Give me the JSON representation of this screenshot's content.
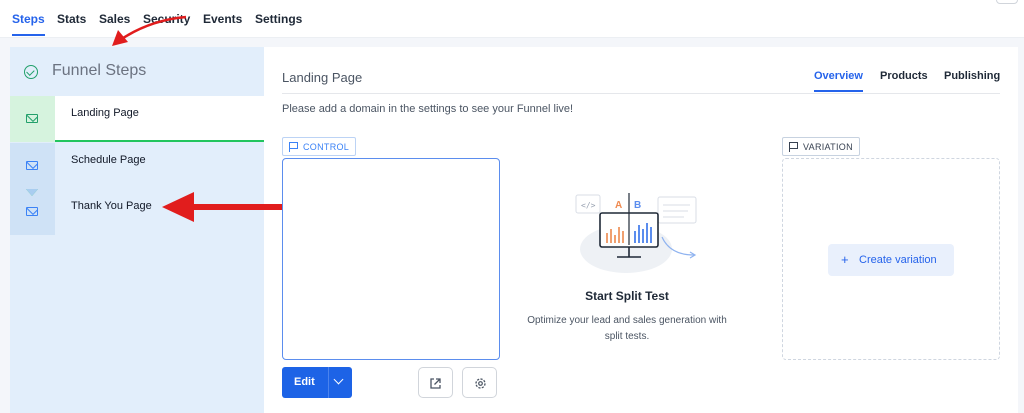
{
  "top_tabs": [
    {
      "label": "Steps",
      "active": true
    },
    {
      "label": "Stats",
      "active": false
    },
    {
      "label": "Sales",
      "active": false
    },
    {
      "label": "Security",
      "active": false
    },
    {
      "label": "Events",
      "active": false
    },
    {
      "label": "Settings",
      "active": false
    }
  ],
  "sidebar": {
    "title": "Funnel Steps",
    "title_icon": "check-circle-icon",
    "steps": [
      {
        "label": "Landing Page",
        "icon": "mail-icon",
        "active": true
      },
      {
        "label": "Schedule Page",
        "icon": "mail-icon",
        "active": false
      },
      {
        "label": "Thank You Page",
        "icon": "mail-icon",
        "active": false
      }
    ]
  },
  "main": {
    "page_title": "Landing Page",
    "subtabs": [
      {
        "label": "Overview",
        "active": true
      },
      {
        "label": "Products",
        "active": false
      },
      {
        "label": "Publishing",
        "active": false
      }
    ],
    "notice": "Please add a domain in the settings to see your Funnel live!",
    "control_tag": "CONTROL",
    "variation_tag": "VARIATION",
    "edit_label": "Edit",
    "split_test": {
      "title": "Start Split Test",
      "description": "Optimize your lead and sales generation with split tests.",
      "label_a": "A",
      "label_b": "B"
    },
    "create_variation_label": "Create variation"
  },
  "colors": {
    "accent": "#2563eb",
    "success": "#22c55e",
    "annotation": "#e11d1d",
    "sidebar_bg": "#e2eefb"
  }
}
